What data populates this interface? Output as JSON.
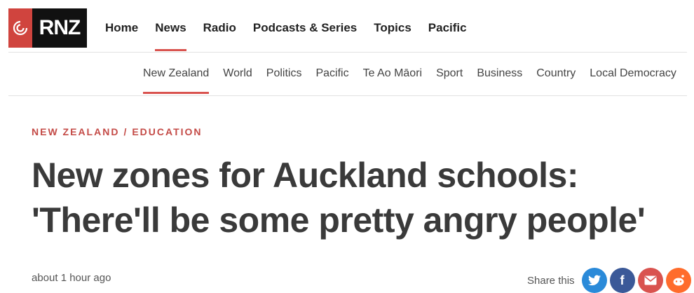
{
  "brand": {
    "name": "RNZ"
  },
  "primary_nav": [
    {
      "label": "Home"
    },
    {
      "label": "News"
    },
    {
      "label": "Radio"
    },
    {
      "label": "Podcasts & Series"
    },
    {
      "label": "Topics"
    },
    {
      "label": "Pacific"
    }
  ],
  "secondary_nav": [
    {
      "label": "New Zealand"
    },
    {
      "label": "World"
    },
    {
      "label": "Politics"
    },
    {
      "label": "Pacific"
    },
    {
      "label": "Te Ao Māori"
    },
    {
      "label": "Sport"
    },
    {
      "label": "Business"
    },
    {
      "label": "Country"
    },
    {
      "label": "Local Democracy"
    }
  ],
  "article": {
    "kicker_section": "NEW ZEALAND",
    "kicker_separator": "/",
    "kicker_subsection": "EDUCATION",
    "headline": "New zones for Auckland schools: 'There'll be some pretty angry people'",
    "timestamp": "about 1 hour ago"
  },
  "share": {
    "label": "Share this",
    "icons": {
      "twitter": "twitter-icon",
      "facebook": "facebook-icon",
      "email": "email-icon",
      "reddit": "reddit-icon"
    }
  },
  "colors": {
    "accent": "#d9534f",
    "brand_red": "#d0443e",
    "brand_black": "#111111",
    "twitter": "#2a8ad9",
    "facebook": "#3b5998",
    "email": "#d9534f",
    "reddit": "#ff6c2c"
  }
}
